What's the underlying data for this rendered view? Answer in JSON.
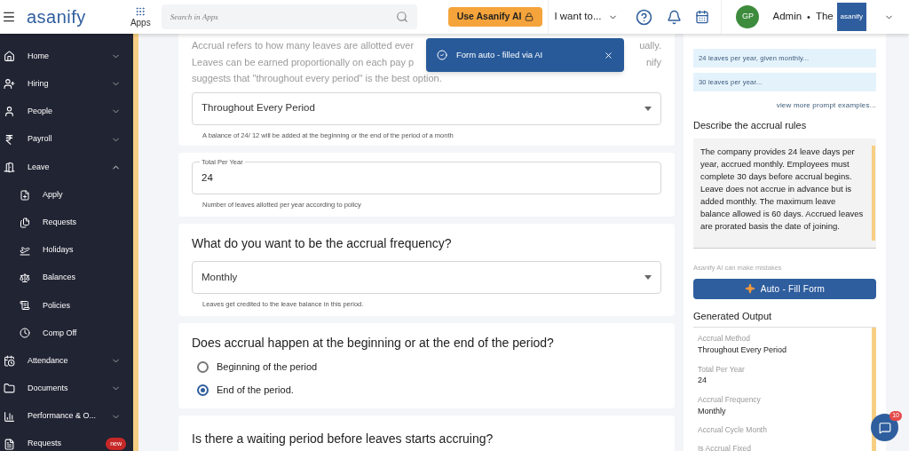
{
  "header": {
    "logo": "asanify",
    "apps_label": "Apps",
    "search": {
      "placeholder": "Search in Apps"
    },
    "ai_button": "Use Asanify AI",
    "quick_menu": "I want to...",
    "avatar": "GP",
    "user_role": "Admin",
    "separator": "•",
    "company": "The",
    "company_logo": "asanify"
  },
  "sidebar": {
    "items": [
      {
        "label": "Home",
        "kind": "group",
        "expanded": false
      },
      {
        "label": "Hiring",
        "kind": "group",
        "expanded": false
      },
      {
        "label": "People",
        "kind": "group",
        "expanded": false
      },
      {
        "label": "Payroll",
        "kind": "group",
        "expanded": false
      },
      {
        "label": "Leave",
        "kind": "group",
        "expanded": true,
        "children": [
          {
            "label": "Apply"
          },
          {
            "label": "Requests"
          },
          {
            "label": "Holidays"
          },
          {
            "label": "Balances"
          },
          {
            "label": "Policies"
          },
          {
            "label": "Comp Off"
          }
        ]
      },
      {
        "label": "Attendance",
        "kind": "group",
        "expanded": false
      },
      {
        "label": "Documents",
        "kind": "group",
        "expanded": false
      },
      {
        "label": "Performance & O...",
        "kind": "group",
        "expanded": false
      },
      {
        "label": "Requests",
        "kind": "link",
        "badge": "new"
      }
    ]
  },
  "toast": {
    "message": "Form auto - filled via AI"
  },
  "form": {
    "method_card": {
      "description_lines": [
        {
          "left": "Accrual refers to how many leaves are allotted ever",
          "right": "ually."
        },
        {
          "left": "Leaves can be earned proportionally on each pay p",
          "right": "nify"
        },
        {
          "left": "suggests that \"throughout every period\" is the best option."
        }
      ],
      "select": "Throughout Every Period",
      "helper": "A balance of 24/ 12 will be added at the beginning or the end of the period of a month"
    },
    "total_card": {
      "label": "Total Per Year",
      "value": "24",
      "helper": "Number of leaves allotted per year according to policy"
    },
    "frequency_card": {
      "question": "What do you want to be the accrual frequency?",
      "select": "Monthly",
      "helper": "Leaves get credited to the leave balance in this period."
    },
    "timing_card": {
      "question": "Does accrual happen at the beginning or at the end of the period?",
      "options": [
        {
          "label": "Beginning of the period",
          "selected": false
        },
        {
          "label": "End of the period.",
          "selected": true
        }
      ]
    },
    "waiting_card": {
      "question": "Is there a waiting period before leaves starts accruing?"
    }
  },
  "ai_panel": {
    "prompt_examples": [
      "24 leaves per year, given monthly...",
      "30 leaves per year..."
    ],
    "more_link": "view more prompt examples...",
    "rules_title": "Describe the accrual rules",
    "rules_text": "The company provides 24 leave days per year, accrued monthly. Employees must complete 30 days before accrual begins. Leave does not accrue in advance but is added monthly. The maximum leave balance allowed is 60 days. Accrued leaves are prorated basis the date of joining.",
    "disclaimer": "Asanify AI can make mistakes",
    "fill_button": "Auto - Fill Form",
    "output_title": "Generated Output",
    "output": [
      {
        "label": "Accrual Method",
        "value": "Throughout Every Period"
      },
      {
        "label": "Total Per Year",
        "value": "24"
      },
      {
        "label": "Accrual Frequency",
        "value": "Monthly"
      },
      {
        "label": "Accrual Cycle Month"
      },
      {
        "label": "Is Accrual Fixed"
      }
    ]
  },
  "chat": {
    "badge": "10"
  }
}
